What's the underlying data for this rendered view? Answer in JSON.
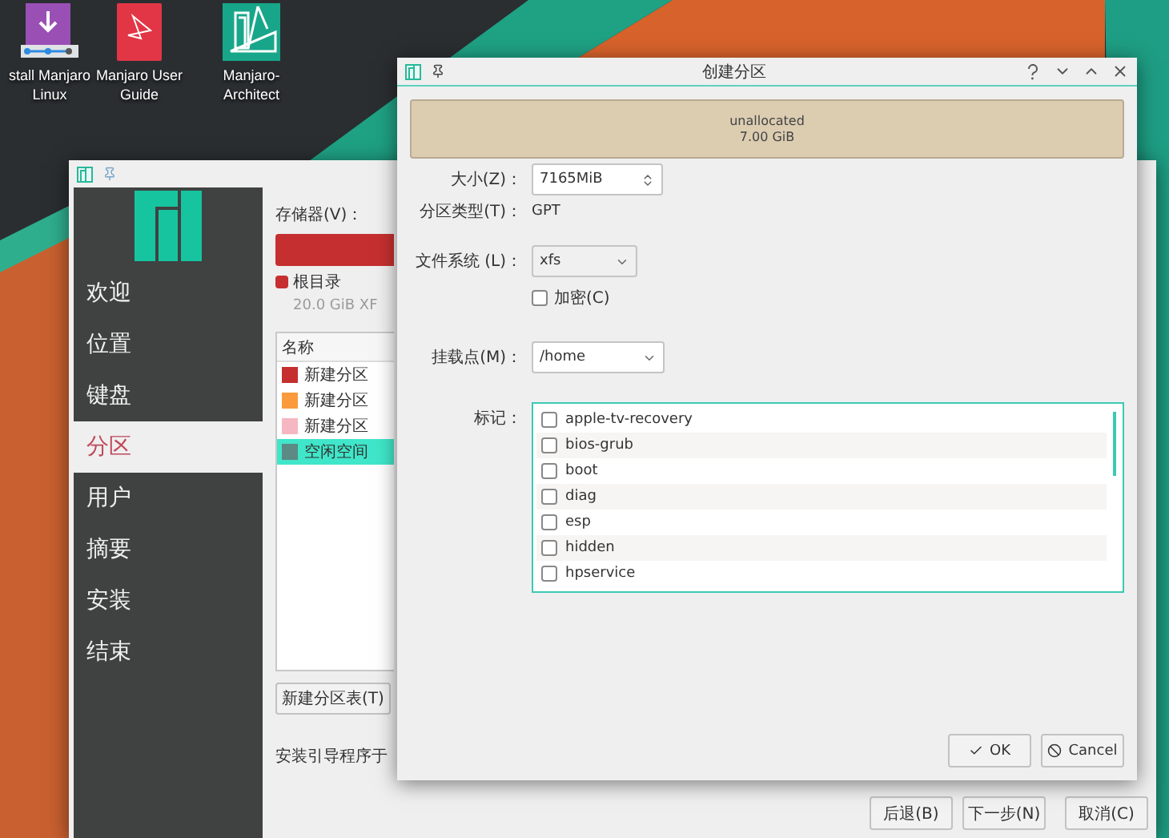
{
  "desktop_icons": [
    {
      "label": "stall Manjaro Linux",
      "kind": "installer"
    },
    {
      "label": "Manjaro User Guide",
      "kind": "guide"
    },
    {
      "label": "Manjaro-Architect",
      "kind": "architect"
    }
  ],
  "installer_window": {
    "sidebar": [
      {
        "label": "欢迎",
        "selected": false
      },
      {
        "label": "位置",
        "selected": false
      },
      {
        "label": "键盘",
        "selected": false
      },
      {
        "label": "分区",
        "selected": true
      },
      {
        "label": "用户",
        "selected": false
      },
      {
        "label": "摘要",
        "selected": false
      },
      {
        "label": "安装",
        "selected": false
      },
      {
        "label": "结束",
        "selected": false
      }
    ],
    "storage_label": "存储器(V)：",
    "legend": {
      "label": "根目录",
      "color": "#c62f2f",
      "size": "20.0 GiB  XF"
    },
    "table": {
      "columns": [
        "名称"
      ],
      "rows": [
        {
          "name": "新建分区",
          "color": "#c62f2f",
          "selected": false
        },
        {
          "name": "新建分区",
          "color": "#fb9a3c",
          "selected": false
        },
        {
          "name": "新建分区",
          "color": "#f5b7c2",
          "selected": false
        },
        {
          "name": "空闲空间",
          "color": "#5c8a84",
          "selected": true
        }
      ]
    },
    "new_table_button": "新建分区表(T)",
    "bootloader_label": "安装引导程序于",
    "buttons": [
      "后退(B)",
      "下一步(N)",
      "取消(C)"
    ]
  },
  "dialog": {
    "title": "创建分区",
    "bar": {
      "label": "unallocated",
      "size": "7.00 GiB"
    },
    "size": {
      "label": "大小(Z)：",
      "value": "7165MiB"
    },
    "partition_type": {
      "label": "分区类型(T)：",
      "value": "GPT"
    },
    "file_system": {
      "label": "文件系统 (L)：",
      "value": "xfs"
    },
    "encrypt": {
      "label": "加密(C)",
      "checked": false
    },
    "mount_point": {
      "label": "挂载点(M)：",
      "value": "/home"
    },
    "flags": {
      "label": "标记：",
      "items": [
        {
          "label": "apple-tv-recovery",
          "checked": false
        },
        {
          "label": "bios-grub",
          "checked": false
        },
        {
          "label": "boot",
          "checked": false
        },
        {
          "label": "diag",
          "checked": false
        },
        {
          "label": "esp",
          "checked": false
        },
        {
          "label": "hidden",
          "checked": false
        },
        {
          "label": "hpservice",
          "checked": false
        }
      ]
    },
    "buttons": [
      {
        "label": "OK",
        "kind": "ok"
      },
      {
        "label": "Cancel",
        "kind": "cancel"
      }
    ]
  }
}
